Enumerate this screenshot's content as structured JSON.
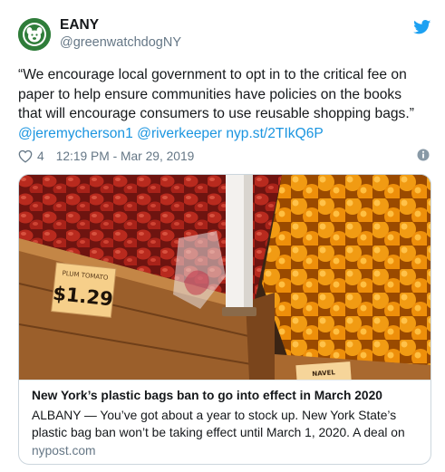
{
  "user": {
    "name": "EANY",
    "handle": "@greenwatchdogNY"
  },
  "tweet": {
    "lines": [
      "“We encourage local government to opt in to the critical fee on",
      "paper to help ensure communities have policies on the books",
      "that will encourage consumers to use reusable shopping bags.”"
    ],
    "mentions": [
      "@jeremycherson1",
      "@riverkeeper"
    ],
    "link": "nyp.st/2TIkQ6P"
  },
  "meta": {
    "likes": "4",
    "timestamp": "12:19 PM - Mar 29, 2019"
  },
  "card": {
    "title": "New York’s plastic bags ban to go into effect in March 2020",
    "description_lines": [
      "ALBANY — You’ve got about a year to stock up. New York State’s",
      "plastic bag ban won’t be taking effect until March 1, 2020. A deal on"
    ],
    "domain": "nypost.com",
    "image": {
      "sign_label": "PLUM TOMATO",
      "sign_price": "$1.29",
      "sign2_label": "NAVEL"
    }
  },
  "icons": {
    "bird": "twitter-bird-icon",
    "heart": "heart-icon",
    "info": "info-icon"
  },
  "colors": {
    "link": "#1b95e0",
    "secondary": "#657786",
    "brand": "#1da1f2"
  }
}
